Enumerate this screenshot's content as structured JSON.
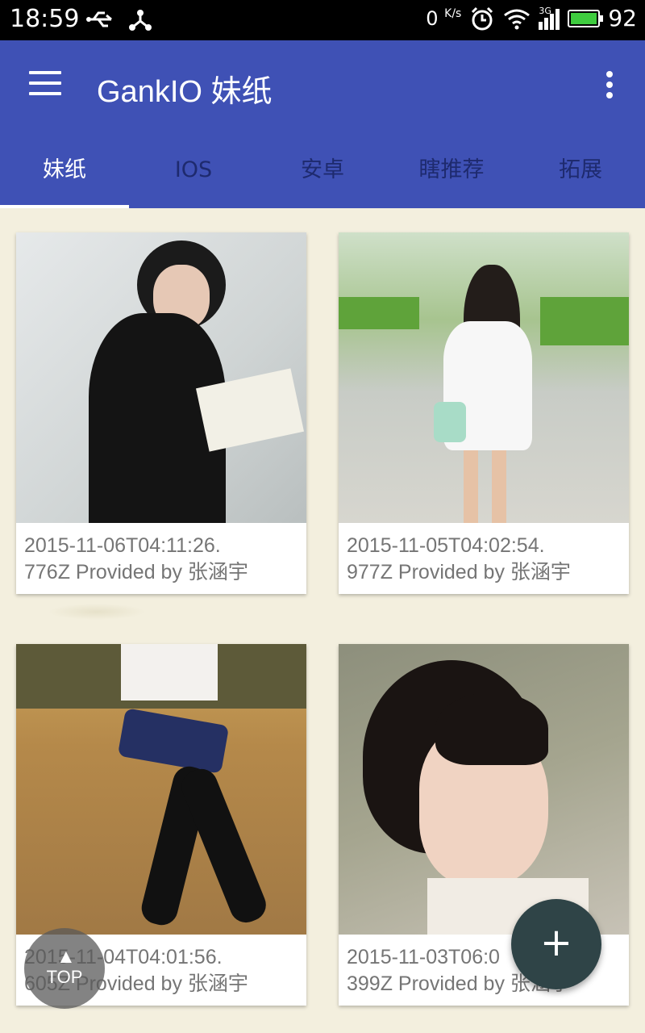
{
  "status_bar": {
    "time": "18:59",
    "speed": "0",
    "speed_unit": "K/s",
    "network": "3G",
    "battery": "92",
    "battery_level": 0.92
  },
  "toolbar": {
    "title": "GankIO 妹纸",
    "color": "#3f51b5"
  },
  "tabs": [
    {
      "label": "妹纸",
      "active": true
    },
    {
      "label": "IOS",
      "active": false
    },
    {
      "label": "安卓",
      "active": false
    },
    {
      "label": "瞎推荐",
      "active": false
    },
    {
      "label": "拓展",
      "active": false
    }
  ],
  "cards": [
    {
      "caption_line1": "2015-11-06T04:11:26.",
      "caption_line2": "776Z Provided by 张涵宇"
    },
    {
      "caption_line1": "2015-11-05T04:02:54.",
      "caption_line2": "977Z Provided by 张涵宇"
    },
    {
      "caption_line1": "2015-11-04T04:01:56.",
      "caption_line2": "605Z Provided by 张涵宇"
    },
    {
      "caption_line1": "2015-11-03T06:0",
      "caption_line2": "399Z Provided by 张涵宇"
    }
  ],
  "fab": {
    "label": "+"
  },
  "top_button": {
    "label": "TOP"
  }
}
